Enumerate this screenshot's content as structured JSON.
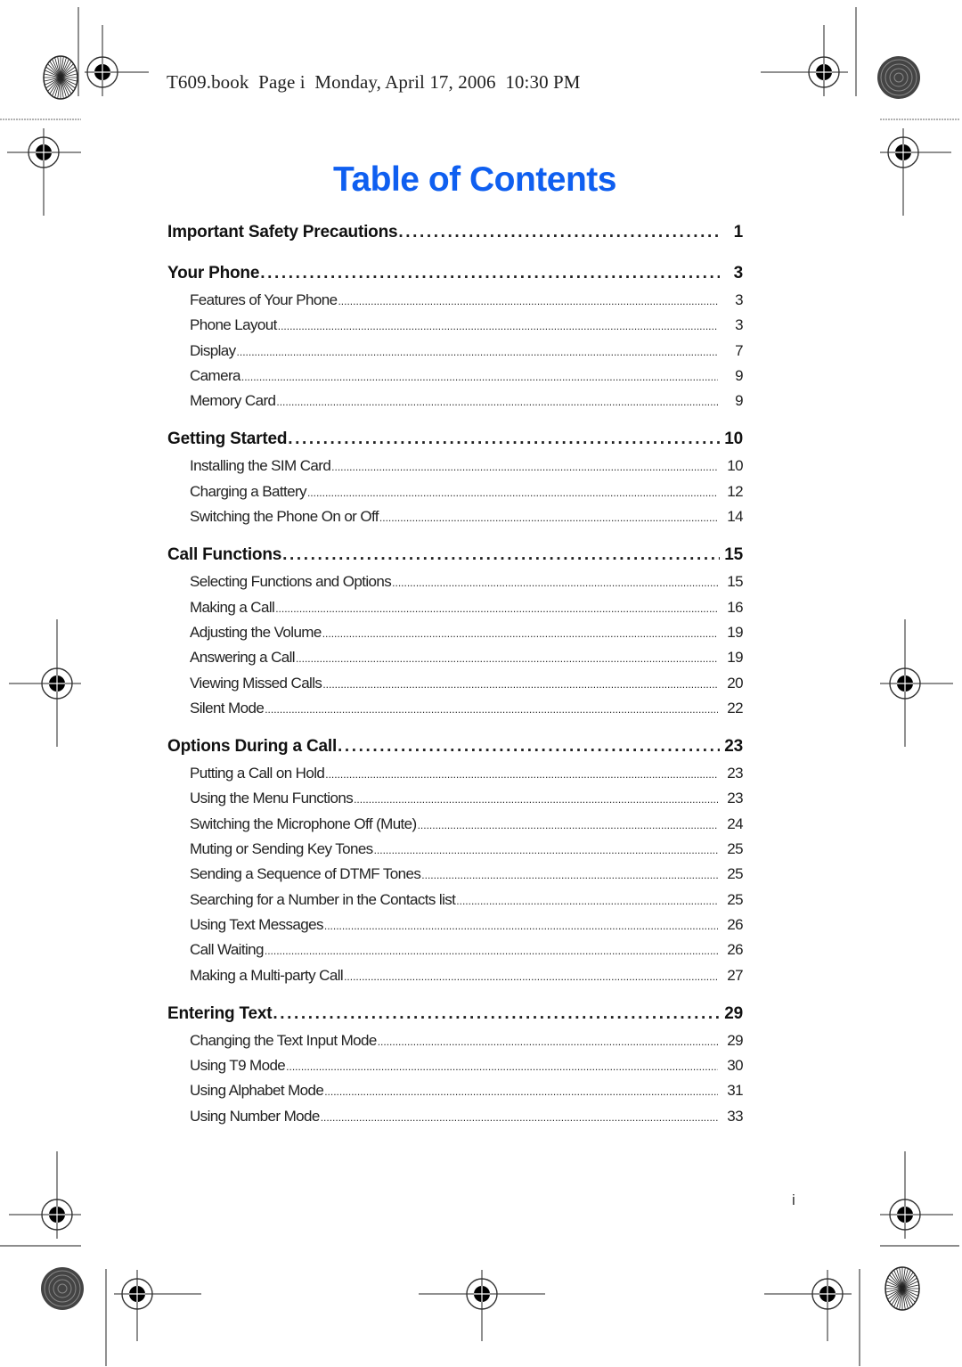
{
  "header": {
    "running_head": "T609.book  Page i  Monday, April 17, 2006  10:30 PM"
  },
  "title": "Table of Contents",
  "toc": [
    {
      "title": "Important Safety Precautions",
      "page": "1",
      "entries": []
    },
    {
      "title": "Your Phone",
      "page": "3",
      "entries": [
        {
          "title": "Features of Your Phone",
          "page": "3"
        },
        {
          "title": "Phone Layout",
          "page": "3"
        },
        {
          "title": "Display",
          "page": "7"
        },
        {
          "title": "Camera",
          "page": "9"
        },
        {
          "title": "Memory Card",
          "page": "9"
        }
      ]
    },
    {
      "title": "Getting Started",
      "page": "10",
      "entries": [
        {
          "title": "Installing the SIM Card",
          "page": "10"
        },
        {
          "title": "Charging a Battery",
          "page": "12"
        },
        {
          "title": "Switching the Phone On or Off",
          "page": "14"
        }
      ]
    },
    {
      "title": "Call Functions",
      "page": "15",
      "entries": [
        {
          "title": "Selecting Functions and Options",
          "page": "15"
        },
        {
          "title": "Making a Call",
          "page": "16"
        },
        {
          "title": "Adjusting the Volume",
          "page": "19"
        },
        {
          "title": "Answering a Call",
          "page": "19"
        },
        {
          "title": "Viewing Missed Calls",
          "page": "20"
        },
        {
          "title": "Silent Mode",
          "page": "22"
        }
      ]
    },
    {
      "title": "Options During a Call",
      "page": "23",
      "entries": [
        {
          "title": "Putting a Call on Hold",
          "page": "23"
        },
        {
          "title": "Using the Menu Functions",
          "page": "23"
        },
        {
          "title": "Switching the Microphone Off (Mute)",
          "page": "24"
        },
        {
          "title": "Muting or Sending Key Tones",
          "page": "25"
        },
        {
          "title": "Sending a Sequence of DTMF Tones",
          "page": "25"
        },
        {
          "title": "Searching for a Number in the Contacts list",
          "page": "25"
        },
        {
          "title": "Using Text Messages",
          "page": "26"
        },
        {
          "title": "Call Waiting",
          "page": "26"
        },
        {
          "title": "Making a Multi-party Call",
          "page": "27"
        }
      ]
    },
    {
      "title": "Entering Text",
      "page": "29",
      "entries": [
        {
          "title": "Changing the Text Input Mode",
          "page": "29"
        },
        {
          "title": "Using T9 Mode",
          "page": "30"
        },
        {
          "title": "Using Alphabet Mode",
          "page": "31"
        },
        {
          "title": "Using Number Mode",
          "page": "33"
        }
      ]
    }
  ],
  "footer": {
    "page_number": "i"
  },
  "colors": {
    "title": "#0f5ff0"
  }
}
